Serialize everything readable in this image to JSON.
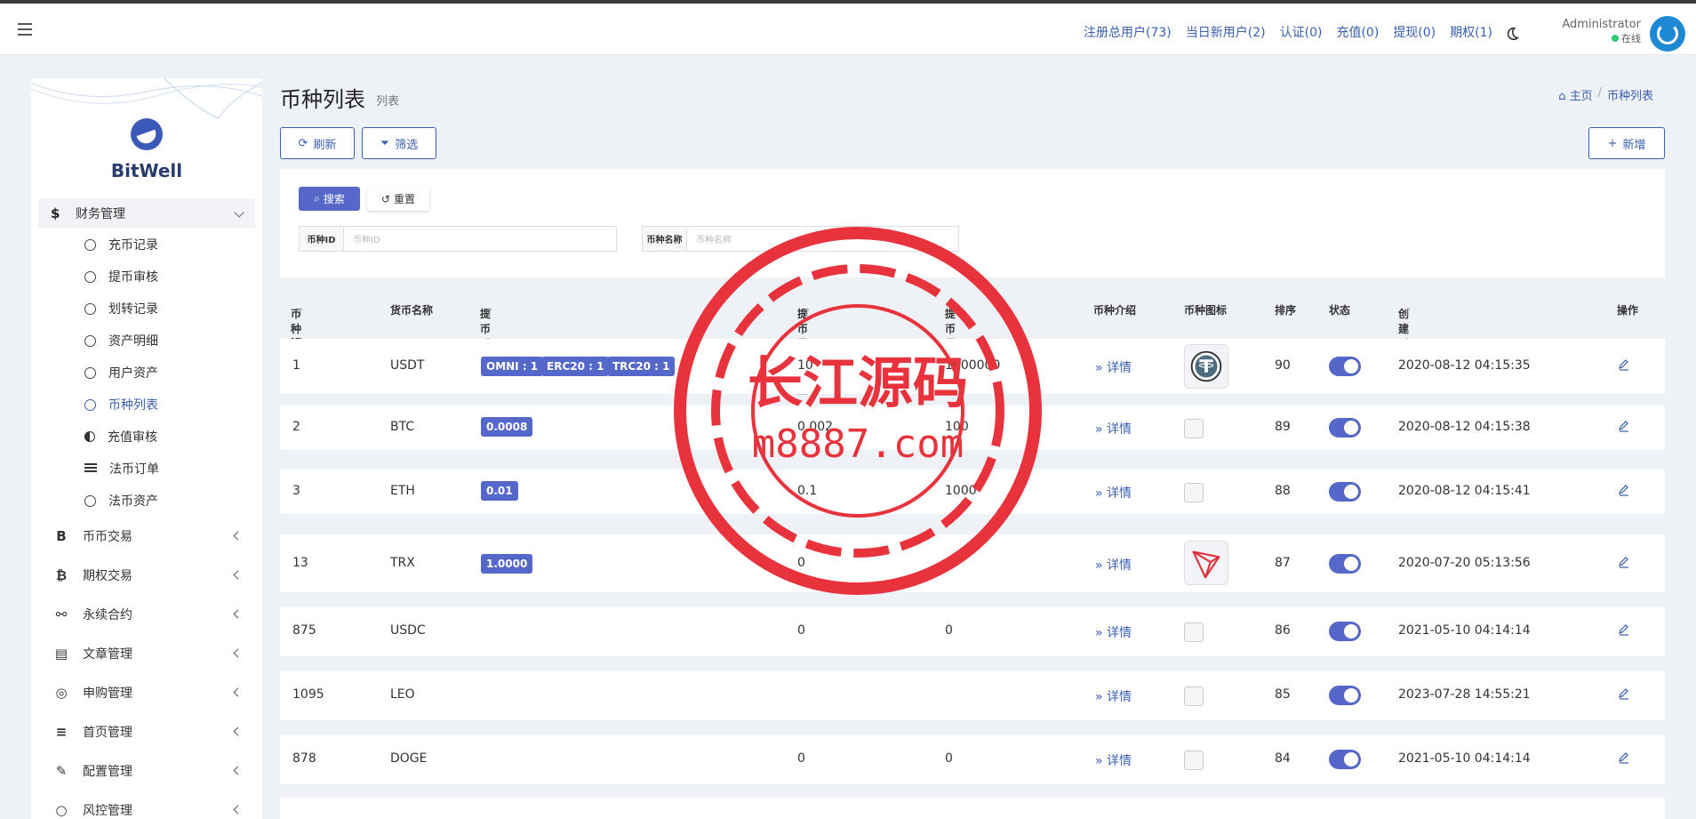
{
  "topbar": {
    "links": [
      "注册总用户(73)",
      "当日新用户(2)",
      "认证(0)",
      "充值(0)",
      "提现(0)",
      "期权(1)"
    ],
    "username": "Administrator",
    "status": "在线"
  },
  "sidebar": {
    "brand": "BitWell",
    "group_open": {
      "icon": "$",
      "label": "财务管理"
    },
    "sub_items": [
      "充币记录",
      "提币审核",
      "划转记录",
      "资产明细",
      "用户资产",
      "币种列表",
      "充值审核",
      "法币订单",
      "法币资产"
    ],
    "main_items": [
      {
        "icon": "B",
        "label": "币币交易"
      },
      {
        "icon": "₿",
        "label": "期权交易"
      },
      {
        "icon": "⚯",
        "label": "永续合约"
      },
      {
        "icon": "▤",
        "label": "文章管理"
      },
      {
        "icon": "◎",
        "label": "申购管理"
      },
      {
        "icon": "≡",
        "label": "首页管理"
      },
      {
        "icon": "✎",
        "label": "配置管理"
      },
      {
        "icon": "○",
        "label": "风控管理"
      }
    ]
  },
  "page": {
    "title": "币种列表",
    "subtitle": "列表",
    "breadcrumb": [
      "主页",
      "币种列表"
    ],
    "refresh": "刷新",
    "filter": "筛选",
    "add": "新增"
  },
  "filter": {
    "search": "搜索",
    "reset": "重置",
    "id_label": "币种ID",
    "id_placeholder": "币种ID",
    "name_label": "币种名称",
    "name_placeholder": "币种名称"
  },
  "table": {
    "headers": {
      "id": "币种ID",
      "name": "货币名称",
      "fee": "提币手续费",
      "min": "提币最小数量",
      "max": "提币最大数量",
      "intro": "币种介绍",
      "icon": "币种图标",
      "sort": "排序",
      "status": "状态",
      "created": "创建时间",
      "action": "操作"
    },
    "detail_label": "详情",
    "rows": [
      {
        "id": "1",
        "name": "USDT",
        "fees": [
          "OMNI : 1",
          "ERC20 : 1",
          "TRC20 : 1"
        ],
        "min": "10",
        "max": "1000000",
        "sort": "90",
        "created": "2020-08-12 04:15:35"
      },
      {
        "id": "2",
        "name": "BTC",
        "fees": [
          "0.0008"
        ],
        "min": "0.002",
        "max": "100",
        "sort": "89",
        "created": "2020-08-12 04:15:38"
      },
      {
        "id": "3",
        "name": "ETH",
        "fees": [
          "0.01"
        ],
        "min": "0.1",
        "max": "1000",
        "sort": "88",
        "created": "2020-08-12 04:15:41"
      },
      {
        "id": "13",
        "name": "TRX",
        "fees": [
          "1.0000"
        ],
        "min": "0",
        "max": "0",
        "sort": "87",
        "created": "2020-07-20 05:13:56"
      },
      {
        "id": "875",
        "name": "USDC",
        "fees": [],
        "min": "0",
        "max": "0",
        "sort": "86",
        "created": "2021-05-10 04:14:14"
      },
      {
        "id": "1095",
        "name": "LEO",
        "fees": [],
        "min": "",
        "max": "",
        "sort": "85",
        "created": "2023-07-28 14:55:21"
      },
      {
        "id": "878",
        "name": "DOGE",
        "fees": [],
        "min": "0",
        "max": "0",
        "sort": "84",
        "created": "2021-05-10 04:14:14"
      }
    ]
  },
  "watermark": {
    "line1": "长江源码",
    "line2": "m8887.com"
  },
  "colors": {
    "accent": "#5567c8",
    "link": "#3a5fae",
    "stamp": "#e8323c"
  }
}
